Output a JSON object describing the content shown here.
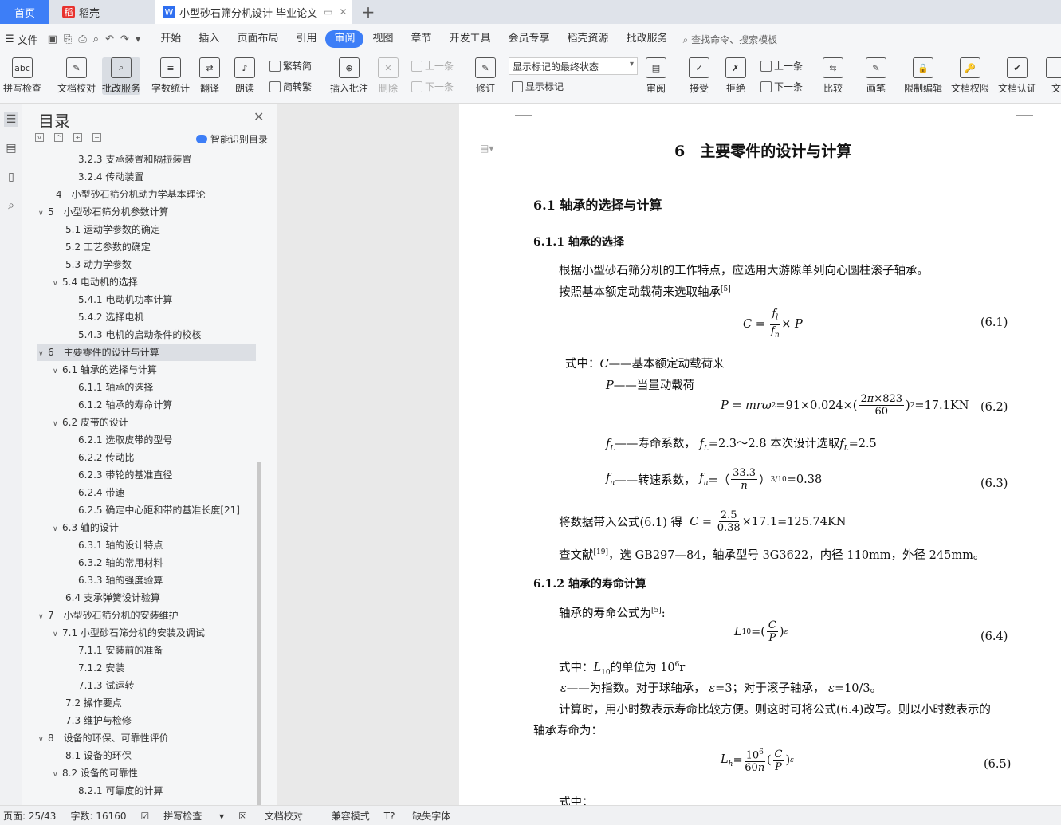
{
  "tabs": {
    "home": "首页",
    "dk": "稻壳",
    "doc": "小型砂石筛分机设计 毕业论文",
    "plus": "+"
  },
  "menu": {
    "file": "文件",
    "items": [
      "开始",
      "插入",
      "页面布局",
      "引用",
      "审阅",
      "视图",
      "章节",
      "开发工具",
      "会员专享",
      "稻壳资源",
      "批改服务"
    ],
    "active": "审阅",
    "search": "查找命令、搜索模板"
  },
  "ribbon": {
    "big": [
      "拼写检查",
      "文档校对",
      "批改服务",
      "字数统计",
      "翻译",
      "朗读",
      "插入批注",
      "删除",
      "修订",
      "审阅",
      "接受",
      "拒绝",
      "比较",
      "画笔",
      "限制编辑",
      "文档权限",
      "文档认证",
      "文"
    ],
    "small": {
      "fan": "繁转简",
      "jian": "简转繁",
      "prev": "上一条",
      "next": "下一条",
      "show": "显示标记",
      "prev2": "上一条",
      "next2": "下一条"
    },
    "dropdown": "显示标记的最终状态"
  },
  "toc": {
    "title": "目录",
    "smart": "智能识别目录",
    "items": [
      {
        "label": "3.2.3 支承装置和隔振装置",
        "level": 3,
        "chev": ""
      },
      {
        "label": "3.2.4 传动装置",
        "level": 3,
        "chev": ""
      },
      {
        "label": "4　小型砂石筛分机动力学基本理论",
        "level": 1,
        "chev": ""
      },
      {
        "label": "5　小型砂石筛分机参数计算",
        "level": 1,
        "chev": "v"
      },
      {
        "label": "5.1 运动学参数的确定",
        "level": 2,
        "chev": ""
      },
      {
        "label": "5.2 工艺参数的确定",
        "level": 2,
        "chev": ""
      },
      {
        "label": "5.3 动力学参数",
        "level": 2,
        "chev": ""
      },
      {
        "label": "5.4 电动机的选择",
        "level": 2,
        "chev": "v"
      },
      {
        "label": "5.4.1 电动机功率计算",
        "level": 3,
        "chev": ""
      },
      {
        "label": "5.4.2 选择电机",
        "level": 3,
        "chev": ""
      },
      {
        "label": "5.4.3 电机的启动条件的校核",
        "level": 3,
        "chev": ""
      },
      {
        "label": "6　主要零件的设计与计算",
        "level": 1,
        "chev": "v",
        "sel": true
      },
      {
        "label": "6.1 轴承的选择与计算",
        "level": 2,
        "chev": "v"
      },
      {
        "label": "6.1.1 轴承的选择",
        "level": 3,
        "chev": ""
      },
      {
        "label": "6.1.2 轴承的寿命计算",
        "level": 3,
        "chev": ""
      },
      {
        "label": "6.2 皮带的设计",
        "level": 2,
        "chev": "v"
      },
      {
        "label": "6.2.1 选取皮带的型号",
        "level": 3,
        "chev": ""
      },
      {
        "label": "6.2.2 传动比",
        "level": 3,
        "chev": ""
      },
      {
        "label": "6.2.3 带轮的基准直径",
        "level": 3,
        "chev": ""
      },
      {
        "label": "6.2.4 带速",
        "level": 3,
        "chev": ""
      },
      {
        "label": "6.2.5 确定中心距和带的基准长度[21]",
        "level": 3,
        "chev": ""
      },
      {
        "label": "6.3 轴的设计",
        "level": 2,
        "chev": "v"
      },
      {
        "label": "6.3.1 轴的设计特点",
        "level": 3,
        "chev": ""
      },
      {
        "label": "6.3.2 轴的常用材料",
        "level": 3,
        "chev": ""
      },
      {
        "label": "6.3.3 轴的强度验算",
        "level": 3,
        "chev": ""
      },
      {
        "label": "6.4 支承弹簧设计验算",
        "level": 2,
        "chev": ""
      },
      {
        "label": "7　小型砂石筛分机的安装维护",
        "level": 1,
        "chev": "v"
      },
      {
        "label": "7.1 小型砂石筛分机的安装及调试",
        "level": 2,
        "chev": "v"
      },
      {
        "label": "7.1.1 安装前的准备",
        "level": 3,
        "chev": ""
      },
      {
        "label": "7.1.2 安装",
        "level": 3,
        "chev": ""
      },
      {
        "label": "7.1.3 试运转",
        "level": 3,
        "chev": ""
      },
      {
        "label": "7.2 操作要点",
        "level": 2,
        "chev": ""
      },
      {
        "label": "7.3 维护与检修",
        "level": 2,
        "chev": ""
      },
      {
        "label": "8　设备的环保、可靠性评价",
        "level": 1,
        "chev": "v"
      },
      {
        "label": "8.1 设备的环保",
        "level": 2,
        "chev": ""
      },
      {
        "label": "8.2 设备的可靠性",
        "level": 2,
        "chev": "v"
      },
      {
        "label": "8.2.1 可靠度的计算",
        "level": 3,
        "chev": ""
      }
    ]
  },
  "doc": {
    "h1": "6　主要零件的设计与计算",
    "h2": "6.1 轴承的选择与计算",
    "h3a": "6.1.1 轴承的选择",
    "p1": "根据小型砂石筛分机的工作特点，应选用大游隙单列向心圆柱滚子轴承。",
    "p2": "按照基本额定动载荷来选取轴承",
    "ref5": "[5]",
    "eq1no": "(6.1)",
    "sz": "式中：",
    "c_desc": "——基本额定动载荷来",
    "p_desc": "——当量动载荷",
    "eq2": "=91×0.024×(",
    "eq2r": "=17.1KN",
    "eq2no": "(6.2)",
    "fl_desc": "——寿命系数，",
    "fl_val": "=2.3～2.8  本次设计选取",
    "fl_val2": "=2.5",
    "fn_desc": "——转速系数，",
    "fn_val": "=0.38",
    "eq3no": "(6.3)",
    "p3": "将数据带入公式(6.1)  得",
    "p3r": "×17.1=125.74KN",
    "p4a": "查文献",
    "ref19": "[19]",
    "p4b": "，选 GB297—84，轴承型号 3G3622，内径 110mm，外径 245mm。",
    "h3b": "6.1.2 轴承的寿命计算",
    "p5": "轴承的寿命公式为",
    "eq4no": "(6.4)",
    "p6": "的单位为 10",
    "p6b": "r",
    "p7": "——为指数。对于球轴承，",
    "p7b": "=3；对于滚子轴承，",
    "p7c": "=10/3。",
    "p8": "计算时，用小时数表示寿命比较方便。则这时可将公式(6.4)改写。则以小时数表示的",
    "p9": "轴承寿命为：",
    "eq5no": "(6.5)",
    "sz2": "式中："
  },
  "status": {
    "page": "页面: 25/43",
    "words": "字数: 16160",
    "spell": "拼写检查",
    "proof": "文档校对",
    "compat": "兼容模式",
    "font": "缺失字体"
  }
}
